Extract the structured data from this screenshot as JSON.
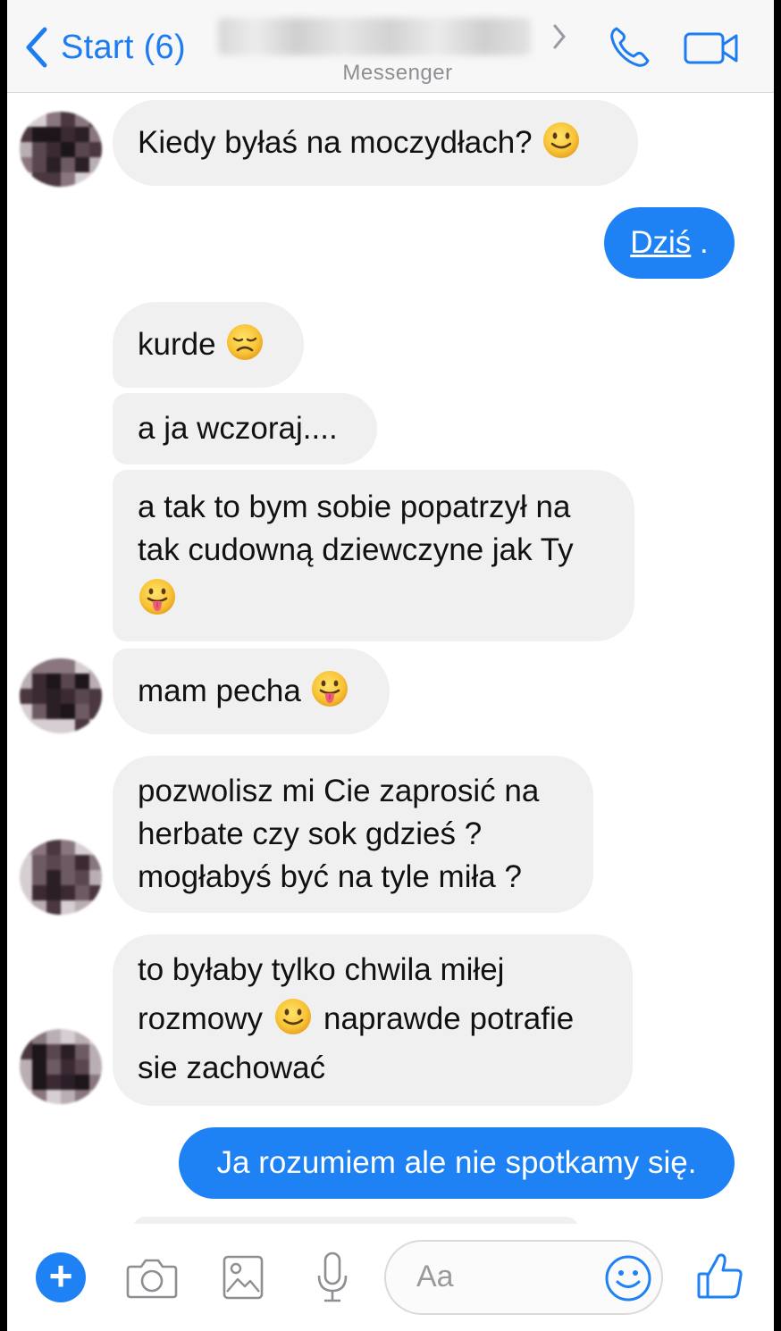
{
  "header": {
    "back_label": "Start (6)",
    "subtitle": "Messenger"
  },
  "messages": [
    {
      "id": "m1",
      "direction": "incoming",
      "text": "Kiedy byłaś na moczydłach?",
      "emoji": "slight-smile"
    },
    {
      "id": "m2",
      "direction": "outgoing",
      "text_link": "Dziś",
      "text_suffix": " ."
    },
    {
      "id": "m3",
      "direction": "incoming",
      "text": "kurde",
      "emoji": "disappointed"
    },
    {
      "id": "m4",
      "direction": "incoming",
      "text": "a ja wczoraj...."
    },
    {
      "id": "m5",
      "direction": "incoming",
      "lines": [
        "a tak to bym sobie popatrzył na",
        "tak cudowną dziewczyne jak Ty"
      ],
      "emoji": "tongue-out"
    },
    {
      "id": "m6",
      "direction": "incoming",
      "text": "mam pecha",
      "emoji": "tongue-out"
    },
    {
      "id": "m7",
      "direction": "incoming",
      "lines": [
        "pozwolisz mi Cie zaprosić na",
        "herbate czy sok gdzieś ?",
        "mogłabyś być na tyle miła ?"
      ]
    },
    {
      "id": "m8",
      "direction": "incoming",
      "line1": "to byłaby tylko chwila miłej",
      "line2_a": "rozmowy",
      "line2_b": "naprawde potrafie",
      "line3": "sie zachować",
      "emoji": "slight-smile"
    },
    {
      "id": "m9",
      "direction": "outgoing",
      "text": "Ja rozumiem ale nie spotkamy się."
    }
  ],
  "composer": {
    "placeholder": "Aa",
    "icons": [
      "plus-icon",
      "camera-icon",
      "image-icon",
      "microphone-icon",
      "emoji-icon",
      "thumbs-up-icon"
    ]
  },
  "colors": {
    "accent": "#1e82f5",
    "incoming_bubble": "#f0f0f0",
    "header_bg": "#f7f7f8"
  }
}
